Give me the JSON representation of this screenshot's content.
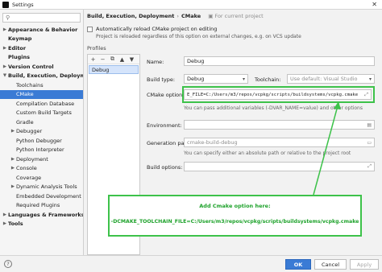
{
  "window": {
    "title": "Settings",
    "controls": "✕"
  },
  "sidebar": {
    "search_placeholder": "",
    "items": [
      {
        "label": "Appearance & Behavior",
        "arrow": "▶",
        "indent": 0
      },
      {
        "label": "Keymap",
        "arrow": "",
        "indent": 0
      },
      {
        "label": "Editor",
        "arrow": "▶",
        "indent": 0
      },
      {
        "label": "Plugins",
        "arrow": "",
        "indent": 0
      },
      {
        "label": "Version Control",
        "arrow": "▶",
        "indent": 0
      },
      {
        "label": "Build, Execution, Deployment",
        "arrow": "▼",
        "indent": 0
      },
      {
        "label": "Toolchains",
        "arrow": "",
        "indent": 1
      },
      {
        "label": "CMake",
        "arrow": "",
        "indent": 1,
        "selected": true
      },
      {
        "label": "Compilation Database",
        "arrow": "",
        "indent": 1
      },
      {
        "label": "Custom Build Targets",
        "arrow": "",
        "indent": 1
      },
      {
        "label": "Gradle",
        "arrow": "",
        "indent": 1
      },
      {
        "label": "Debugger",
        "arrow": "▶",
        "indent": 1
      },
      {
        "label": "Python Debugger",
        "arrow": "",
        "indent": 1
      },
      {
        "label": "Python Interpreter",
        "arrow": "",
        "indent": 1
      },
      {
        "label": "Deployment",
        "arrow": "▶",
        "indent": 1
      },
      {
        "label": "Console",
        "arrow": "▶",
        "indent": 1
      },
      {
        "label": "Coverage",
        "arrow": "",
        "indent": 1
      },
      {
        "label": "Dynamic Analysis Tools",
        "arrow": "▶",
        "indent": 1
      },
      {
        "label": "Embedded Development",
        "arrow": "",
        "indent": 1
      },
      {
        "label": "Required Plugins",
        "arrow": "",
        "indent": 1
      },
      {
        "label": "Languages & Frameworks",
        "arrow": "▶",
        "indent": 0
      },
      {
        "label": "Tools",
        "arrow": "▶",
        "indent": 0
      }
    ]
  },
  "breadcrumb": {
    "parent": "Build, Execution, Deployment",
    "separator": "›",
    "current": "CMake",
    "note": "For current project"
  },
  "reload": {
    "label": "Automatically reload CMake project on editing",
    "note": "Project is reloaded regardless of this option on external changes, e.g. on VCS update"
  },
  "profiles": {
    "label": "Profiles",
    "toolbar": [
      "+",
      "−",
      "⧉",
      "▲",
      "▼"
    ],
    "items": [
      "Debug"
    ]
  },
  "form": {
    "name_label": "Name:",
    "name_value": "Debug",
    "build_type_label": "Build type:",
    "build_type_value": "Debug",
    "toolchain_label": "Toolchain:",
    "toolchain_value": "Use default: Visual Studio",
    "cmake_options_label": "CMake options:",
    "cmake_options_value": "E_FILE=C:/Users/m3/repos/vcpkg/scripts/buildsystems/vcpkg.cmake",
    "cmake_options_hint": "You can pass additional variables (-DVAR_NAME=value) and other options",
    "environment_label": "Environment:",
    "environment_value": "",
    "generation_path_label": "Generation path:",
    "generation_path_value": "cmake-build-debug",
    "generation_path_hint": "You can specify either an absolute path or relative to the project root",
    "build_options_label": "Build options:",
    "build_options_value": ""
  },
  "annotation": {
    "title": "Add Cmake option here:",
    "command": "-DCMAKE_TOOLCHAIN_FILE=C:/Users/m3/repos/vcpkg/scripts/buildsystems/vcpkg.cmake",
    "color": "#3dc24a"
  },
  "buttons": {
    "help": "?",
    "ok": "OK",
    "cancel": "Cancel",
    "apply": "Apply"
  }
}
